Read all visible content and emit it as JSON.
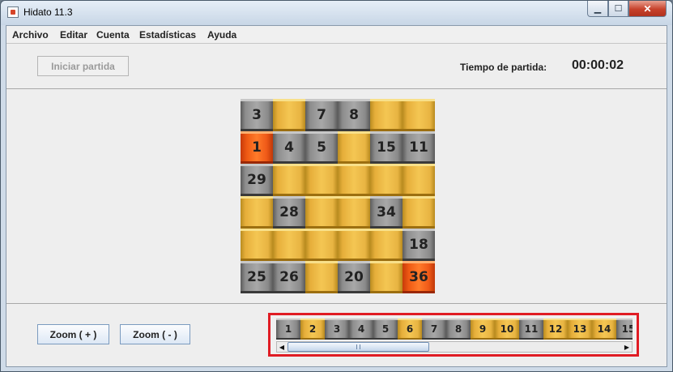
{
  "window": {
    "title": "Hidato 11.3"
  },
  "titlebar": {
    "min": "▁",
    "max": "☐",
    "close": "✕"
  },
  "menu": [
    "Archivo",
    "Editar",
    "Cuenta",
    "Estadísticas",
    "Ayuda"
  ],
  "top": {
    "start_label": "Iniciar partida",
    "time_label": "Tiempo de partida:",
    "time_value": "00:00:02"
  },
  "board": {
    "rows": [
      [
        {
          "v": "3",
          "c": "gray"
        },
        {
          "v": "",
          "c": "gold"
        },
        {
          "v": "7",
          "c": "gray"
        },
        {
          "v": "8",
          "c": "gray"
        },
        {
          "v": "",
          "c": "gold"
        },
        {
          "v": "",
          "c": "gold"
        }
      ],
      [
        {
          "v": "1",
          "c": "red"
        },
        {
          "v": "4",
          "c": "gray"
        },
        {
          "v": "5",
          "c": "gray"
        },
        {
          "v": "",
          "c": "gold"
        },
        {
          "v": "15",
          "c": "gray"
        },
        {
          "v": "11",
          "c": "gray"
        }
      ],
      [
        {
          "v": "29",
          "c": "gray"
        },
        {
          "v": "",
          "c": "gold"
        },
        {
          "v": "",
          "c": "gold"
        },
        {
          "v": "",
          "c": "gold"
        },
        {
          "v": "",
          "c": "gold"
        },
        {
          "v": "",
          "c": "gold"
        }
      ],
      [
        {
          "v": "",
          "c": "gold"
        },
        {
          "v": "28",
          "c": "gray"
        },
        {
          "v": "",
          "c": "gold"
        },
        {
          "v": "",
          "c": "gold"
        },
        {
          "v": "34",
          "c": "gray"
        },
        {
          "v": "",
          "c": "gold"
        }
      ],
      [
        {
          "v": "",
          "c": "gold"
        },
        {
          "v": "",
          "c": "gold"
        },
        {
          "v": "",
          "c": "gold"
        },
        {
          "v": "",
          "c": "gold"
        },
        {
          "v": "",
          "c": "gold"
        },
        {
          "v": "18",
          "c": "gray"
        }
      ],
      [
        {
          "v": "25",
          "c": "gray"
        },
        {
          "v": "26",
          "c": "gray"
        },
        {
          "v": "",
          "c": "gold"
        },
        {
          "v": "20",
          "c": "gray"
        },
        {
          "v": "",
          "c": "gold"
        },
        {
          "v": "36",
          "c": "red"
        }
      ]
    ]
  },
  "zoom": {
    "in_label": "Zoom ( + )",
    "out_label": "Zoom ( - )"
  },
  "palette": [
    {
      "v": "1",
      "c": "gray"
    },
    {
      "v": "2",
      "c": "gold"
    },
    {
      "v": "3",
      "c": "gray"
    },
    {
      "v": "4",
      "c": "gray"
    },
    {
      "v": "5",
      "c": "gray"
    },
    {
      "v": "6",
      "c": "gold"
    },
    {
      "v": "7",
      "c": "gray"
    },
    {
      "v": "8",
      "c": "gray"
    },
    {
      "v": "9",
      "c": "gold"
    },
    {
      "v": "10",
      "c": "gold"
    },
    {
      "v": "11",
      "c": "gray"
    },
    {
      "v": "12",
      "c": "gold"
    },
    {
      "v": "13",
      "c": "gold"
    },
    {
      "v": "14",
      "c": "gold"
    },
    {
      "v": "15",
      "c": "gray"
    }
  ],
  "scroll": {
    "left_arrow": "◀",
    "right_arrow": "▶"
  },
  "colors": {
    "highlight_border": "#e01c24",
    "tile_gold": "#f4c653",
    "tile_gray": "#a8a8a8",
    "tile_red": "#ff7b2a"
  }
}
